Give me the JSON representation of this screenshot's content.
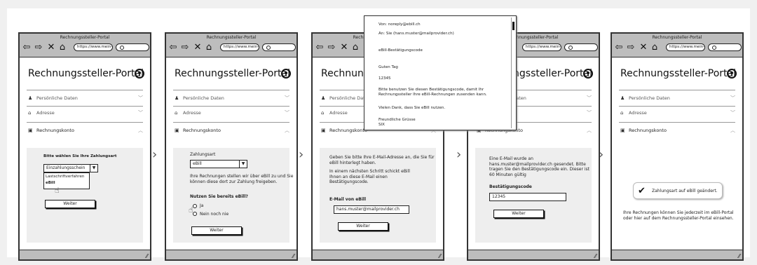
{
  "window_title": "Rechnungssteller-Portal",
  "url": "https://www.mein-re",
  "portal_title": "Rechnungssteller-Portal",
  "sections": {
    "personal": "Persönliche Daten",
    "address": "Adresse",
    "account": "Rechnungskonto"
  },
  "step1": {
    "prompt": "Bitte wählen Sie Ihre Zahlungsart",
    "select_value": "Einzahlungsschein",
    "option1": "Lastschriftverfahren",
    "option2": "eBill",
    "button": "Weiter"
  },
  "step2": {
    "label": "Zahlungsart",
    "select_value": "eBill",
    "info": "Ihre Rechnungen stellen wir über eBill zu und Sie können diese dort zur Zahlung freigeben.",
    "question": "Nutzen Sie bereits eBill?",
    "yes": "Ja",
    "no": "Nein noch nie",
    "button": "Weiter"
  },
  "step3": {
    "text1": "Geben Sie bitte Ihre E-Mail-Adresse an, die Sie für eBill hinterlegt haben.",
    "text2": "In einem nächsten Schritt schickt eBill Ihnen an diese E-Mail einen Bestätigungscode.",
    "email_label": "E-Mail von eBill",
    "email_value": "hans.muster@mailprovider.ch",
    "button": "Weiter"
  },
  "email_popup": {
    "from": "Von: noreply@ebill.ch",
    "to": "An:   Sie (hans.muster@mailprovider.ch)",
    "subject": "eBill-Bestätigungscode",
    "greeting": "Guten Tag",
    "code": "12345",
    "body": "Bitte benutzen Sie diesen Bestätigungscode, damit Ihr Rechnungssteller Ihre eBill-Rechnungen zusenden kann.",
    "thanks": "Vielen Dank, dass Sie eBill nutzen.",
    "regards": "Freundliche Grüsse",
    "sender": "SIX"
  },
  "step4": {
    "text": "Eine E-Mail wurde an hans.muster@mailprovider.ch gesendet. Bitte tragen Sie den Bestätigungscode ein. Dieser ist 60 Minuten gültig",
    "code_label": "Bestätigungscode",
    "code_value": "12345",
    "button": "Weiter"
  },
  "step5": {
    "success": "Zahlungsart auf eBill geändert.",
    "text": "Ihre Rechnungen können Sie jederzeit im eBill-Portal oder hier auf dem Rechnungssteller-Portal einsehen."
  }
}
